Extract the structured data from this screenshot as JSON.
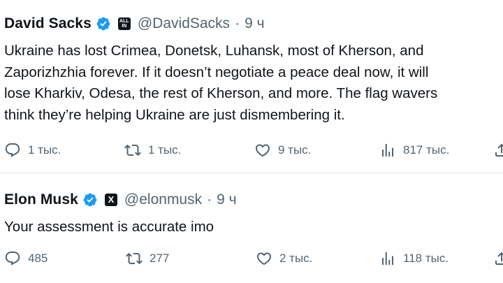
{
  "tweets": [
    {
      "name": "David Sacks",
      "affiliate_badge": "ALL IN",
      "affiliate_icon": "all-in-podcast-logo",
      "handle": "@DavidSacks",
      "separator": "·",
      "time": "9 ч",
      "text_lines": [
        "Ukraine has lost Crimea, Donetsk, Luhansk, most of Kherson, and",
        "Zaporizhzhia forever. If it doesn’t negotiate a peace deal now, it will",
        "lose Kharkiv, Odesa, the rest of Kherson, and more. The flag wavers",
        "think they’re helping Ukraine are just dismembering it."
      ],
      "replies": "1 тыс.",
      "retweets": "1 тыс.",
      "likes": "9 тыс.",
      "views": "817 тыс."
    },
    {
      "name": "Elon Musk",
      "affiliate_badge": "X",
      "affiliate_icon": "x-logo",
      "handle": "@elonmusk",
      "separator": "·",
      "time": "9 ч",
      "text_lines": [
        "Your assessment is accurate imo"
      ],
      "replies": "485",
      "retweets": "277",
      "likes": "2 тыс.",
      "views": "118 тыс."
    }
  ],
  "colors": {
    "text": "#0f1419",
    "secondary": "#536471",
    "verified_blue": "#1d9bf0",
    "divider": "#e7e9ea"
  },
  "icons": [
    "verified-badge-icon",
    "reply-icon",
    "retweet-icon",
    "like-icon",
    "views-icon",
    "share-icon"
  ]
}
